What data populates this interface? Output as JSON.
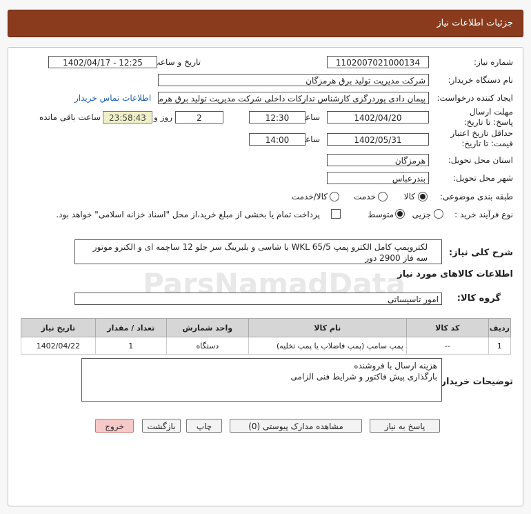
{
  "header": {
    "title": "جزئیات اطلاعات نیاز"
  },
  "fields": {
    "need_number_label": "شماره نیاز:",
    "need_number": "1102007021000134",
    "announce_label": "تاریخ و ساعت اعلان عمومی:",
    "announce_value": "1402/04/17 - 12:25",
    "buyer_label": "نام دستگاه خریدار:",
    "buyer_value": "شرکت مدیریت تولید برق هرمزگان",
    "creator_label": "ایجاد کننده درخواست:",
    "creator_value": "پیمان دادی پوردرگزی کارشناس تدارکات داخلی شرکت مدیریت تولید برق هرمزگان",
    "contact_link": "اطلاعات تماس خریدار",
    "deadline_label": "مهلت ارسال پاسخ: تا تاریخ:",
    "deadline_date": "1402/04/20",
    "time_label": "ساعت",
    "deadline_time": "12:30",
    "days_value": "2",
    "days_label": "روز و",
    "remaining_value": "23:58:43",
    "remaining_label": "ساعت باقی مانده",
    "validity_label": "حداقل تاریخ اعتبار قیمت: تا تاریخ:",
    "validity_date": "1402/05/31",
    "validity_time": "14:00",
    "province_label": "استان محل تحویل:",
    "province_value": "هرمزگان",
    "city_label": "شهر محل تحویل:",
    "city_value": "بندرعباس",
    "category_label": "طبقه بندی موضوعی:",
    "category_options": [
      "کالا",
      "خدمت",
      "کالا/خدمت"
    ],
    "process_label": "نوع فرآیند خرید :",
    "process_options": [
      "جزیی",
      "متوسط"
    ],
    "payment_note": "پرداخت تمام یا بخشی از مبلغ خرید،از محل \"اسناد خزانه اسلامی\" خواهد بود."
  },
  "general_desc": {
    "label": "شرح کلی نیاز:",
    "text": "لکتروپمپ کامل الکترو پمپ WKL 65/5 با شاسی و بلبرینگ سر جلو 12 ساچمه ای و الکترو موتور سه فاز 2900 دور"
  },
  "goods_section": {
    "title": "اطلاعات کالاهای مورد نیاز",
    "group_label": "گروه کالا:",
    "group_value": "امور تاسیساتی"
  },
  "table": {
    "headers": [
      "ردیف",
      "کد کالا",
      "نام کالا",
      "واحد شمارش",
      "تعداد / مقدار",
      "تاریخ نیاز"
    ],
    "rows": [
      [
        "1",
        "--",
        "پمپ سامپ (پمپ فاضلاب یا پمپ تخلیه)",
        "دستگاه",
        "1",
        "1402/04/22"
      ]
    ]
  },
  "buyer_notes": {
    "label": "توضیحات خریدار:",
    "line1": "هزینه ارسال با فروشنده",
    "line2": "بارگذاری پیش فاکتور و شرایط فنی الزامی"
  },
  "buttons": {
    "reply": "پاسخ به نیاز",
    "attachments": "مشاهده مدارک پیوستی (0)",
    "print": "چاپ",
    "back": "بازگشت",
    "exit": "خروج"
  },
  "colors": {
    "header_bg": "#8a3b1d",
    "link": "#1a5fb4",
    "exit_btn": "#f6c9c9"
  }
}
